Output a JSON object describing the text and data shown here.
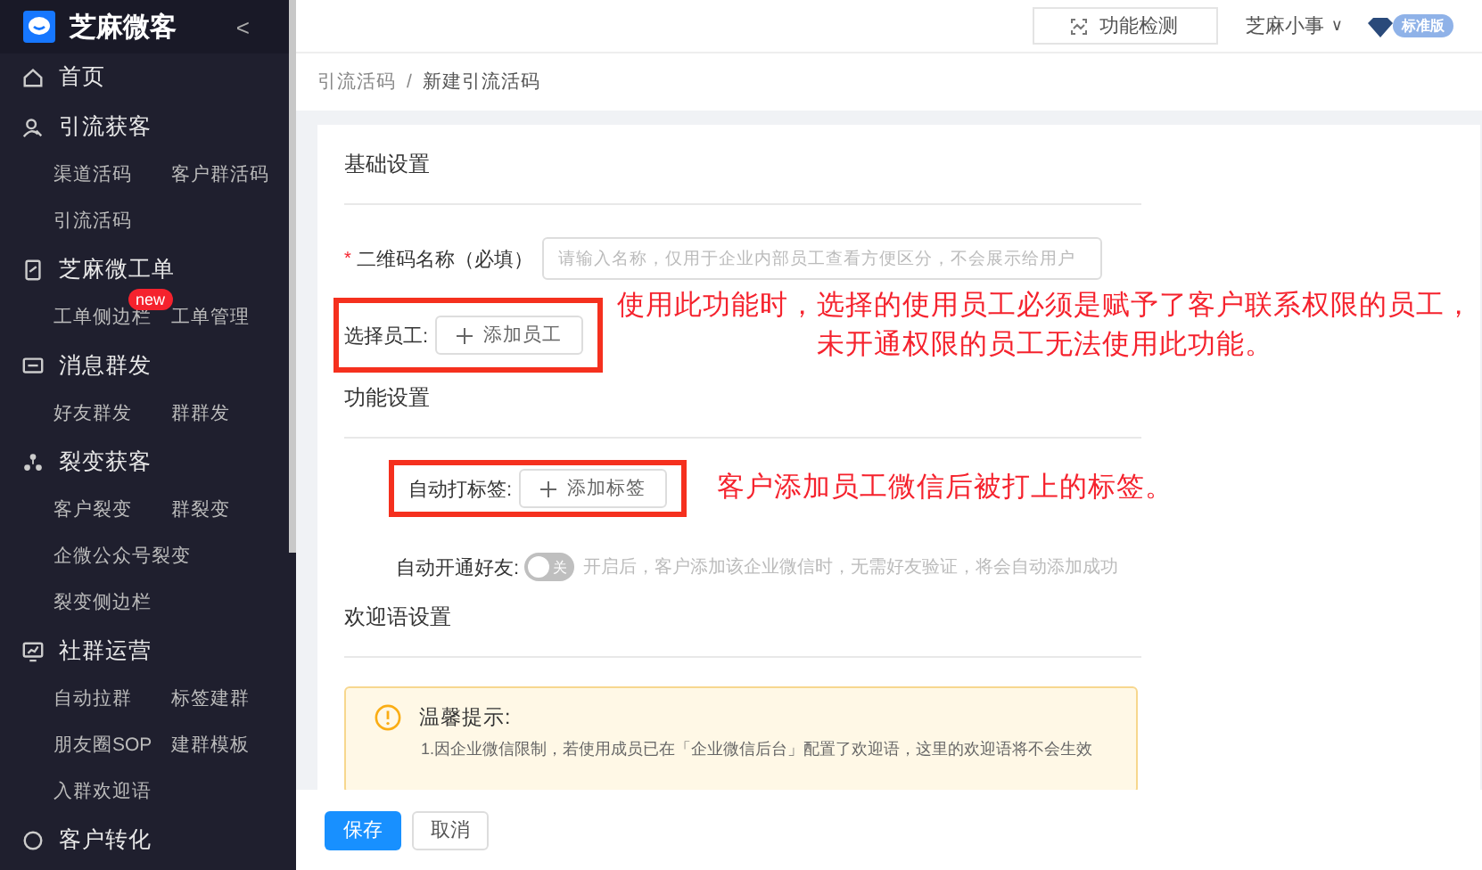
{
  "sidebar": {
    "logo_text": "芝麻微客",
    "collapse": "<",
    "groups": [
      {
        "title": "首页"
      },
      {
        "title": "引流获客",
        "items": [
          {
            "label": "渠道活码"
          },
          {
            "label": "客户群活码"
          },
          {
            "label": "引流活码"
          }
        ]
      },
      {
        "title": "芝麻微工单",
        "items": [
          {
            "label": "工单侧边栏",
            "badge": "new"
          },
          {
            "label": "工单管理"
          }
        ]
      },
      {
        "title": "消息群发",
        "items": [
          {
            "label": "好友群发"
          },
          {
            "label": "群群发"
          }
        ]
      },
      {
        "title": "裂变获客",
        "items": [
          {
            "label": "客户裂变"
          },
          {
            "label": "群裂变"
          },
          {
            "label": "企微公众号裂变"
          },
          {
            "label": "裂变侧边栏"
          }
        ]
      },
      {
        "title": "社群运营",
        "items": [
          {
            "label": "自动拉群"
          },
          {
            "label": "标签建群"
          },
          {
            "label": "朋友圈SOP"
          },
          {
            "label": "建群模板"
          },
          {
            "label": "入群欢迎语"
          }
        ]
      },
      {
        "title": "客户转化"
      }
    ]
  },
  "header": {
    "check_button": "功能检测",
    "user": "芝麻小事",
    "user_caret": "∨",
    "version_badge": "标准版"
  },
  "breadcrumb": [
    "引流活码",
    "新建引流活码"
  ],
  "breadcrumb_separator": "/",
  "form": {
    "section_basic": "基础设置",
    "qr_name": {
      "required_mark": "*",
      "label": "二维码名称（必填）",
      "placeholder": "请输入名称，仅用于企业内部员工查看方便区分，不会展示给用户"
    },
    "employee": {
      "label": "选择员工:",
      "button": "添加员工"
    },
    "employee_note": [
      "使用此功能时，选择的使用员工必须是赋予了客户联系权限的员工，",
      "未开通权限的员工无法使用此功能。"
    ],
    "section_function": "功能设置",
    "tag": {
      "label": "自动打标签:",
      "button": "添加标签"
    },
    "tag_note": "客户添加员工微信后被打上的标签。",
    "auto_friend": {
      "label": "自动开通好友:",
      "on": false,
      "state_text": "关",
      "hint": "开启后，客户添加该企业微信时，无需好友验证，将会自动添加成功"
    },
    "section_welcome": "欢迎语设置",
    "notice": {
      "title": "温馨提示:",
      "text": "1.因企业微信限制，若使用成员已在「企业微信后台」配置了欢迎语，这里的欢迎语将不会生效"
    }
  },
  "footer": {
    "save": "保存",
    "cancel": "取消"
  }
}
